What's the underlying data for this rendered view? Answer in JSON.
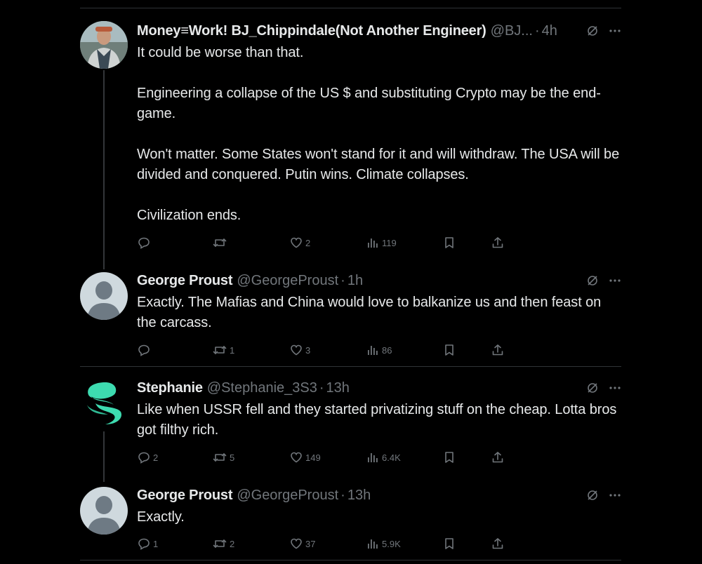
{
  "icons": {
    "reply": "reply-icon",
    "retweet": "retweet-icon",
    "like": "heart-icon",
    "views": "views-icon",
    "bookmark": "bookmark-icon",
    "share": "share-icon",
    "grok": "grok-icon",
    "more": "more-icon"
  },
  "colors": {
    "background": "#000000",
    "text": "#e7e9ea",
    "muted": "#71767b",
    "divider": "#2f3336",
    "stephanie_logo": "#3ddbb0"
  },
  "tweets": [
    {
      "name": "Money≡Work! BJ_Chippindale(Not Another Engineer)",
      "handle": "@BJ...",
      "dot": "·",
      "time": "4h",
      "text": "It could be worse than that.\n\nEngineering a collapse of the US $ and substituting Crypto may be the end-game.\n\nWon't matter. Some States won't stand for it and will withdraw. The USA will be divided and conquered. Putin wins. Climate collapses.\n\nCivilization ends.",
      "replies": "",
      "retweets": "",
      "likes": "2",
      "views": "119"
    },
    {
      "name": "George Proust",
      "handle": "@GeorgeProust",
      "dot": "·",
      "time": "1h",
      "text": "Exactly.  The Mafias and China would love to balkanize us and then feast on the carcass.",
      "replies": "",
      "retweets": "1",
      "likes": "3",
      "views": "86"
    },
    {
      "name": "Stephanie",
      "handle": "@Stephanie_3S3",
      "dot": "·",
      "time": "13h",
      "text": "Like when USSR fell and they started privatizing stuff on the cheap. Lotta bros got filthy rich.",
      "replies": "2",
      "retweets": "5",
      "likes": "149",
      "views": "6.4K"
    },
    {
      "name": "George Proust",
      "handle": "@GeorgeProust",
      "dot": "·",
      "time": "13h",
      "text": "Exactly.",
      "replies": "1",
      "retweets": "2",
      "likes": "37",
      "views": "5.9K"
    }
  ]
}
